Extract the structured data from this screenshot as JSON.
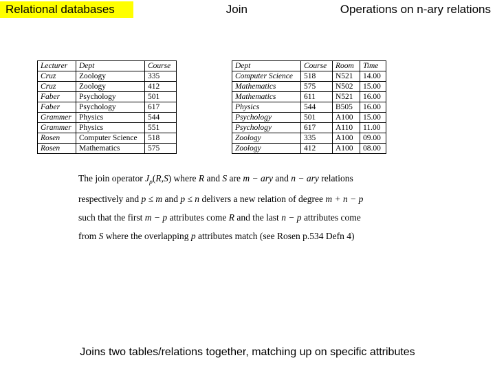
{
  "header": {
    "left": "Relational databases",
    "center": "Join",
    "right": "Operations on n-ary relations"
  },
  "table1": {
    "headers": [
      "Lecturer",
      "Dept",
      "Course"
    ],
    "rows": [
      [
        "Cruz",
        "Zoology",
        "335"
      ],
      [
        "Cruz",
        "Zoology",
        "412"
      ],
      [
        "Faber",
        "Psychology",
        "501"
      ],
      [
        "Faber",
        "Psychology",
        "617"
      ],
      [
        "Grammer",
        "Physics",
        "544"
      ],
      [
        "Grammer",
        "Physics",
        "551"
      ],
      [
        "Rosen",
        "Computer Science",
        "518"
      ],
      [
        "Rosen",
        "Mathematics",
        "575"
      ]
    ]
  },
  "table2": {
    "headers": [
      "Dept",
      "Course",
      "Room",
      "Time"
    ],
    "rows": [
      [
        "Computer Science",
        "518",
        "N521",
        "14.00"
      ],
      [
        "Mathematics",
        "575",
        "N502",
        "15.00"
      ],
      [
        "Mathematics",
        "611",
        "N521",
        "16.00"
      ],
      [
        "Physics",
        "544",
        "B505",
        "16.00"
      ],
      [
        "Psychology",
        "501",
        "A100",
        "15.00"
      ],
      [
        "Psychology",
        "617",
        "A110",
        "11.00"
      ],
      [
        "Zoology",
        "335",
        "A100",
        "09.00"
      ],
      [
        "Zoology",
        "412",
        "A100",
        "08.00"
      ]
    ]
  },
  "description": "The join operator J_p(R,S) where R and S are m−ary and n−ary relations respectively and p ≤ m and p ≤ n delivers a new relation of degree m+n−p such that the first m−p attributes come R and the last n−p attributes come from S where the overlapping p attributes match (see Rosen p.534 Defn 4)",
  "footer": "Joins two tables/relations together, matching up on specific attributes"
}
